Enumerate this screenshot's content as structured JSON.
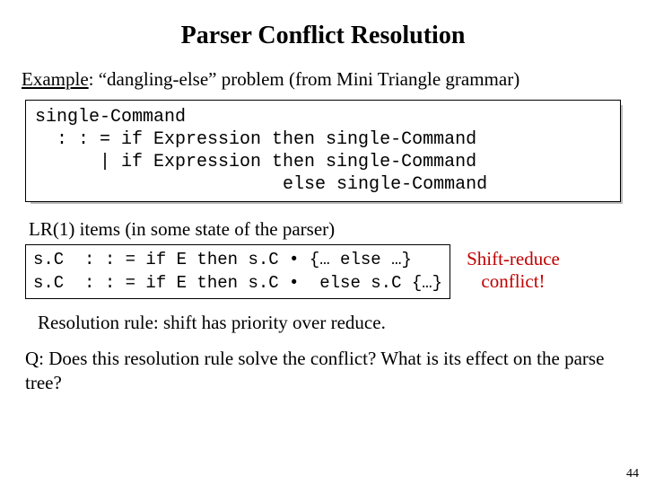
{
  "title": "Parser Conflict Resolution",
  "example_label": "Example",
  "example_rest": ": “dangling-else” problem (from Mini Triangle grammar)",
  "grammar_text": "single-Command\n  : : = if Expression then single-Command\n      | if Expression then single-Command\n                       else single-Command",
  "lr_caption": "LR(1) items (in some state of the parser)",
  "items_text": "s.C  : : = if E then s.C • {… else …}\ns.C  : : = if E then s.C •  else s.C {…}",
  "conflict_line1": "Shift-reduce",
  "conflict_line2": "conflict!",
  "resolution": "Resolution rule: shift has priority over reduce.",
  "question": "Q: Does this resolution rule solve the conflict? What is its effect on the parse tree?",
  "page_number": "44"
}
